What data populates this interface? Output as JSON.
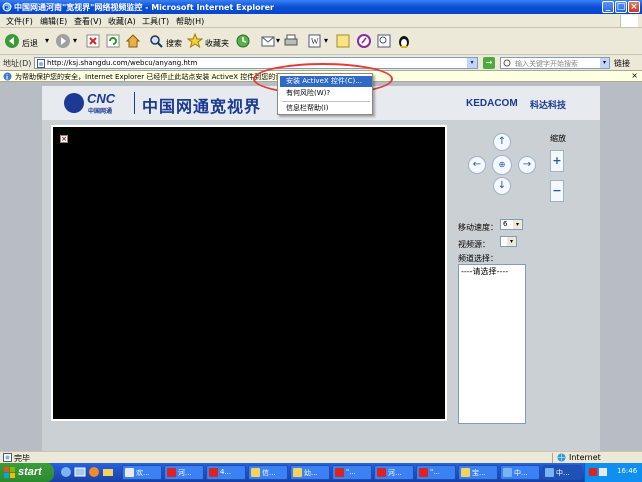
{
  "window": {
    "title": "中国网通河南\"宽视界\"网络视频监控 - Microsoft Internet Explorer"
  },
  "menubar": {
    "items": [
      "文件(F)",
      "编辑(E)",
      "查看(V)",
      "收藏(A)",
      "工具(T)",
      "帮助(H)"
    ]
  },
  "toolbar": {
    "back_label": "后退",
    "search_label": "搜索",
    "favorites_label": "收藏夹"
  },
  "addressbar": {
    "label": "地址(D)",
    "url": "http://ksj.shangdu.com/webcu/anyang.htm",
    "search_placeholder": "输入关键字开始搜索",
    "links_label": "链接"
  },
  "infobar": {
    "message": "为帮助保护您的安全，Internet Explorer 已经停止此站点安装 ActiveX 控件到您的计算机，单击此处查看选项..."
  },
  "context_menu": {
    "items": [
      "安装 ActiveX 控件(C)...",
      "有何风险(W)?",
      "信息栏帮助(I)"
    ],
    "selected": 0
  },
  "page": {
    "brand_cnc": "CNC",
    "brand_cnc_sub": "中国网通",
    "brand_title": "中国网通宽视界",
    "kedacom": "KEDACOM",
    "kedacom_cn": "科达科技",
    "broken_image_mark": "×",
    "zoom_label": "缩放",
    "zoom_in": "+",
    "zoom_out": "−",
    "ptz": {
      "up": "↑",
      "down": "↓",
      "left": "←",
      "right": "→",
      "center": "⊕"
    },
    "speed_label": "移动速度：",
    "speed_value": "6",
    "source_label": "视频源：",
    "source_value": "",
    "channel_label": "频道选择：",
    "channel_placeholder": "----请选择----"
  },
  "statusbar": {
    "status": "完毕",
    "zone": "Internet"
  },
  "taskbar": {
    "start_label": "start",
    "tasks": [
      "欢...",
      "河...",
      "4...",
      "信...",
      "幼...",
      "\"...",
      "河...",
      "\"...",
      "宝...",
      "中...",
      "中..."
    ],
    "active_task": 10,
    "clock": "16:46"
  },
  "colors": {
    "brand_blue": "#1a3a93",
    "highlight_red": "#e63a3a",
    "selection_blue": "#316ac5"
  }
}
